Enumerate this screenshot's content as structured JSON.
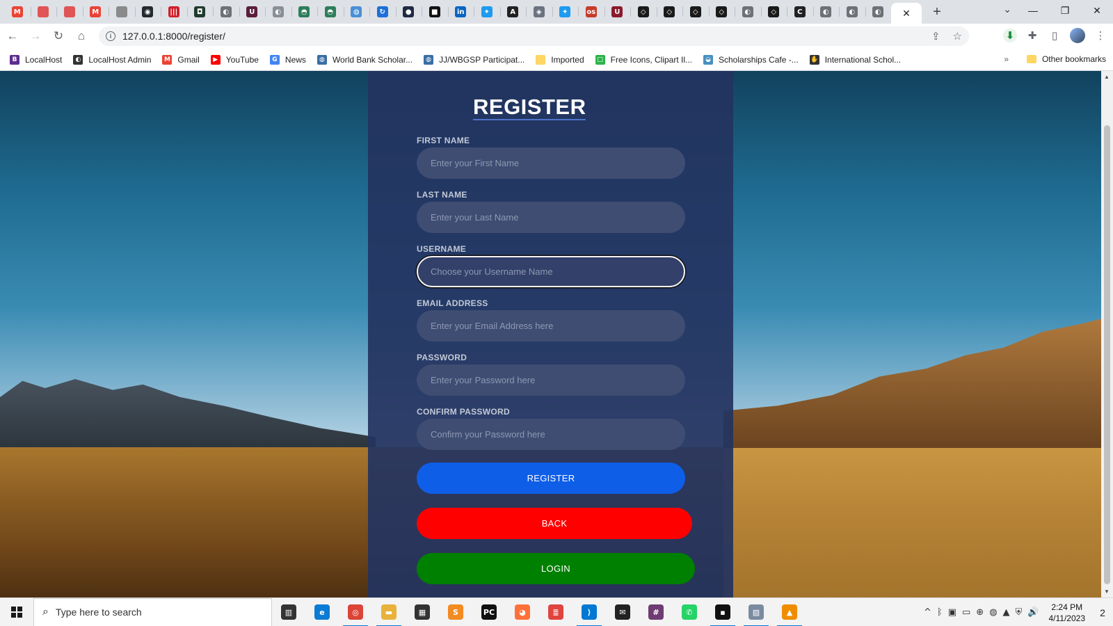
{
  "browser": {
    "tabs": [
      {
        "name": "gmail-tab-icon",
        "glyph": "M",
        "color": "#ea4335"
      },
      {
        "name": "youtube-circle-tab-icon",
        "glyph": "",
        "color": "#e05555"
      },
      {
        "name": "youtube-circle-tab-icon-2",
        "glyph": "",
        "color": "#e05555"
      },
      {
        "name": "gmail-tab-icon-2",
        "glyph": "M",
        "color": "#ea4335"
      },
      {
        "name": "document-tab-icon",
        "glyph": "",
        "color": "#8a8a8a"
      },
      {
        "name": "github-tab-icon",
        "glyph": "◉",
        "color": "#24292e"
      },
      {
        "name": "barcode-tab-icon",
        "glyph": "|||",
        "color": "#d0202a"
      },
      {
        "name": "green-app-tab-icon",
        "glyph": "◘",
        "color": "#1f3b2c"
      },
      {
        "name": "globe-tab-icon",
        "glyph": "◐",
        "color": "#6e7277"
      },
      {
        "name": "udemy-tab-icon",
        "glyph": "U",
        "color": "#5a1e3c"
      },
      {
        "name": "globe-tab-icon-2",
        "glyph": "◐",
        "color": "#8a8f95"
      },
      {
        "name": "dino-tab-icon",
        "glyph": "◓",
        "color": "#2e7d5b"
      },
      {
        "name": "dino-tab-icon-2",
        "glyph": "◓",
        "color": "#2e7d5b"
      },
      {
        "name": "world-tab-icon",
        "glyph": "◍",
        "color": "#4a8fd6"
      },
      {
        "name": "loop-tab-icon",
        "glyph": "↻",
        "color": "#1e6fd9"
      },
      {
        "name": "dark-circle-tab-icon",
        "glyph": "●",
        "color": "#1f2a44"
      },
      {
        "name": "medium-tab-icon",
        "glyph": "■",
        "color": "#111111"
      },
      {
        "name": "linkedin-tab-icon",
        "glyph": "in",
        "color": "#0a66c2"
      },
      {
        "name": "twitter-tab-icon",
        "glyph": "✦",
        "color": "#1d9bf0"
      },
      {
        "name": "ai-tab-icon",
        "glyph": "A",
        "color": "#222222"
      },
      {
        "name": "shield-tab-icon",
        "glyph": "◈",
        "color": "#6b7280"
      },
      {
        "name": "twitter-tab-icon-2",
        "glyph": "✦",
        "color": "#1d9bf0"
      },
      {
        "name": "osu-tab-icon",
        "glyph": "os",
        "color": "#c73b2a"
      },
      {
        "name": "university-tab-icon",
        "glyph": "U",
        "color": "#8b1a2b"
      },
      {
        "name": "codesandbox-tab-icon",
        "glyph": "◇",
        "color": "#1a1a1a"
      },
      {
        "name": "codesandbox-tab-icon-2",
        "glyph": "◇",
        "color": "#1a1a1a"
      },
      {
        "name": "codesandbox-tab-icon-3",
        "glyph": "◇",
        "color": "#1a1a1a"
      },
      {
        "name": "codesandbox-tab-icon-4",
        "glyph": "◇",
        "color": "#1a1a1a"
      },
      {
        "name": "globe-tab-icon-3",
        "glyph": "◐",
        "color": "#6e7277"
      },
      {
        "name": "codesandbox-tab-icon-5",
        "glyph": "◇",
        "color": "#1a1a1a"
      },
      {
        "name": "c-tab-icon",
        "glyph": "C",
        "color": "#222222"
      },
      {
        "name": "globe-tab-icon-4",
        "glyph": "◐",
        "color": "#6e7277"
      },
      {
        "name": "globe-tab-icon-5",
        "glyph": "◐",
        "color": "#6e7277"
      },
      {
        "name": "globe-tab-icon-6",
        "glyph": "◐",
        "color": "#6e7277"
      }
    ],
    "url": "127.0.0.1:8000/register/",
    "bookmarks": [
      {
        "label": "LocalHost",
        "glyph": "B",
        "color": "#5c2d91"
      },
      {
        "label": "LocalHost Admin",
        "glyph": "◐",
        "color": "#333333"
      },
      {
        "label": "Gmail",
        "glyph": "M",
        "color": "#ea4335"
      },
      {
        "label": "YouTube",
        "glyph": "▶",
        "color": "#ff0000"
      },
      {
        "label": "News",
        "glyph": "G",
        "color": "#4285f4"
      },
      {
        "label": "World Bank Scholar...",
        "glyph": "◍",
        "color": "#3a6ea5"
      },
      {
        "label": "JJ/WBGSP Participat...",
        "glyph": "◍",
        "color": "#3a6ea5"
      },
      {
        "label": "Imported",
        "glyph": "",
        "color": "#fdd663"
      },
      {
        "label": "Free Icons, Clipart Il...",
        "glyph": "□",
        "color": "#2db34a"
      },
      {
        "label": "Scholarships Cafe -...",
        "glyph": "◒",
        "color": "#4a90c2"
      },
      {
        "label": "International Schol...",
        "glyph": "✋",
        "color": "#333333"
      }
    ],
    "more_glyph": "»",
    "other_bookmarks": "Other bookmarks"
  },
  "form": {
    "title": "REGISTER",
    "fields": [
      {
        "label": "FIRST NAME",
        "placeholder": "Enter your First Name"
      },
      {
        "label": "LAST NAME",
        "placeholder": "Enter your Last Name"
      },
      {
        "label": "USERNAME",
        "placeholder": "Choose your Username Name"
      },
      {
        "label": "EMAIL ADDRESS",
        "placeholder": "Enter your Email Address here"
      },
      {
        "label": "PASSWORD",
        "placeholder": "Enter your Password here"
      },
      {
        "label": "CONFIRM PASSWORD",
        "placeholder": "Confirm your Password here"
      }
    ],
    "register_label": "REGISTER",
    "back_label": "BACK",
    "login_label": "LOGIN",
    "colors": {
      "panel": "#243460",
      "register": "#0f5ee8",
      "back": "#ff0000",
      "login": "#008000"
    }
  },
  "taskbar": {
    "search_placeholder": "Type here to search",
    "apps": [
      {
        "name": "task-view-icon",
        "glyph": "▥",
        "color": "#333333",
        "running": false
      },
      {
        "name": "edge-icon",
        "glyph": "e",
        "color": "#0c7bd4",
        "running": false
      },
      {
        "name": "chrome-icon",
        "glyph": "◎",
        "color": "#db4437",
        "running": true
      },
      {
        "name": "file-explorer-icon",
        "glyph": "▬",
        "color": "#e8b23a",
        "running": true
      },
      {
        "name": "store-icon",
        "glyph": "▦",
        "color": "#333333",
        "running": false
      },
      {
        "name": "sublime-icon",
        "glyph": "S",
        "color": "#f28b22",
        "running": false
      },
      {
        "name": "pycharm-icon",
        "glyph": "PC",
        "color": "#111111",
        "running": false
      },
      {
        "name": "firefox-icon",
        "glyph": "◕",
        "color": "#ff7139",
        "running": false
      },
      {
        "name": "stack-icon",
        "glyph": "≣",
        "color": "#e0443e",
        "running": false
      },
      {
        "name": "vscode-icon",
        "glyph": "⟩",
        "color": "#0078d4",
        "running": true
      },
      {
        "name": "mail-icon",
        "glyph": "✉",
        "color": "#222222",
        "running": false
      },
      {
        "name": "slack-icon",
        "glyph": "#",
        "color": "#6e3c73",
        "running": false
      },
      {
        "name": "whatsapp-icon",
        "glyph": "✆",
        "color": "#25d366",
        "running": false
      },
      {
        "name": "sticky-notes-icon",
        "glyph": "▪",
        "color": "#111111",
        "running": true
      },
      {
        "name": "photos-icon",
        "glyph": "▨",
        "color": "#7a8aa0",
        "running": true
      },
      {
        "name": "vlc-icon",
        "glyph": "▲",
        "color": "#f08c00",
        "running": true
      }
    ],
    "tray": [
      "^",
      "ᛒ",
      "▣",
      "▭",
      "⊕",
      "◍",
      "▲",
      "⛨",
      "🔊"
    ],
    "time": "2:24 PM",
    "date": "4/11/2023",
    "notifications": "2"
  }
}
